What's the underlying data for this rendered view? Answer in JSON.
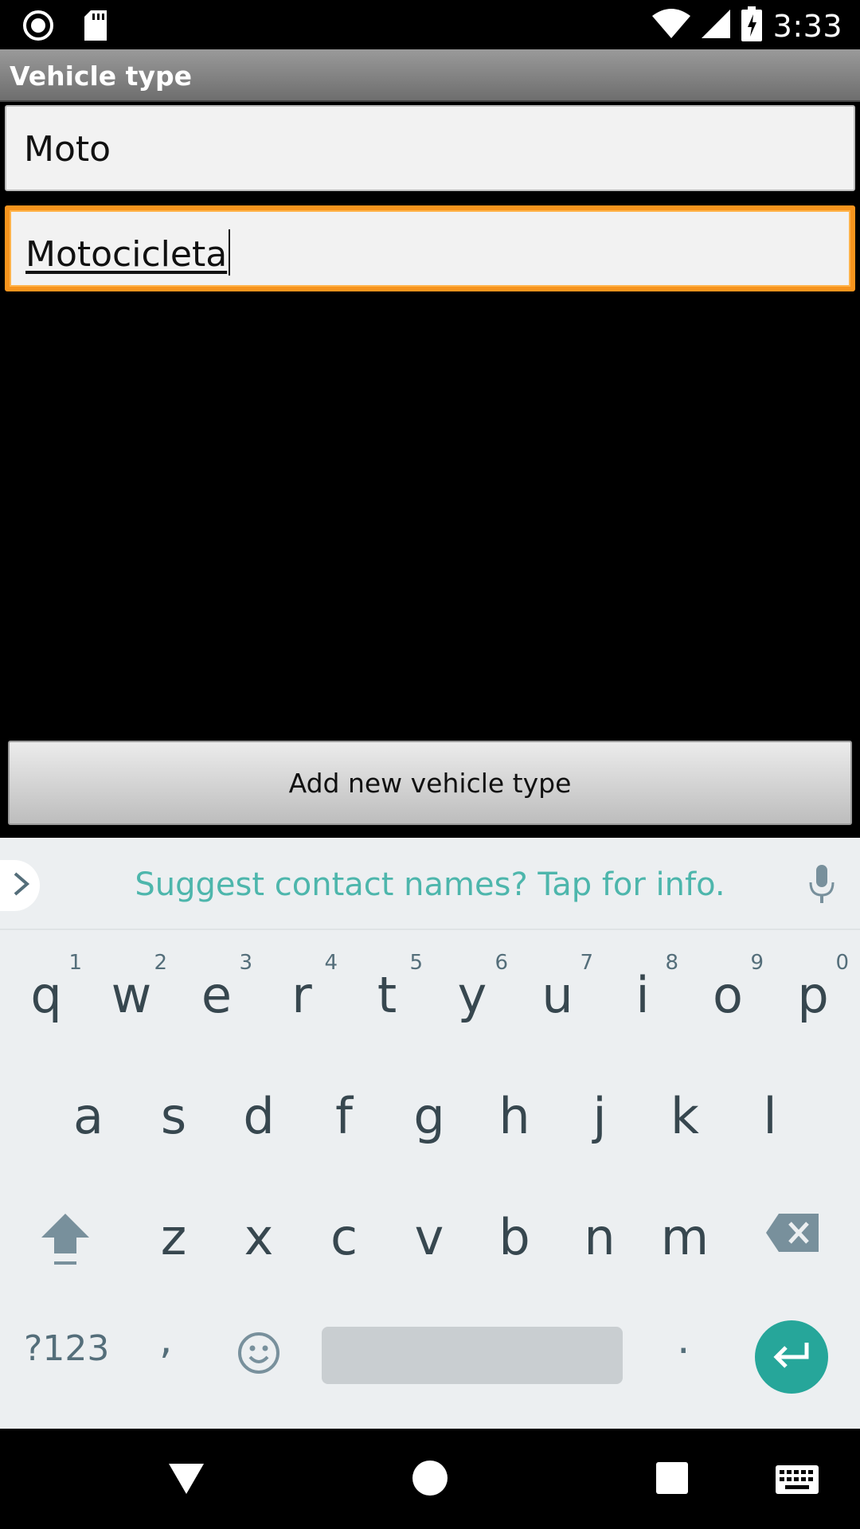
{
  "status_bar": {
    "time": "3:33",
    "left_icons": [
      "record-icon",
      "sd-card-icon"
    ],
    "right_icons": [
      "wifi-icon",
      "cell-signal-icon",
      "battery-charging-icon"
    ]
  },
  "title_bar": {
    "title": "Vehicle type"
  },
  "form": {
    "field1_value": "Moto",
    "field2_value": "Motocicleta",
    "add_button_label": "Add new vehicle type",
    "focus_color": "#f7941d"
  },
  "keyboard": {
    "suggestion": "Suggest contact names? Tap for info.",
    "accent_color": "#4db6ac",
    "row1": [
      {
        "key": "q",
        "hint": "1"
      },
      {
        "key": "w",
        "hint": "2"
      },
      {
        "key": "e",
        "hint": "3"
      },
      {
        "key": "r",
        "hint": "4"
      },
      {
        "key": "t",
        "hint": "5"
      },
      {
        "key": "y",
        "hint": "6"
      },
      {
        "key": "u",
        "hint": "7"
      },
      {
        "key": "i",
        "hint": "8"
      },
      {
        "key": "o",
        "hint": "9"
      },
      {
        "key": "p",
        "hint": "0"
      }
    ],
    "row2": [
      "a",
      "s",
      "d",
      "f",
      "g",
      "h",
      "j",
      "k",
      "l"
    ],
    "row3": [
      "z",
      "x",
      "c",
      "v",
      "b",
      "n",
      "m"
    ],
    "sym_label": "?123",
    "comma": ",",
    "period": "."
  },
  "nav_bar": {
    "icons": [
      "back-icon",
      "home-icon",
      "recents-icon",
      "keyboard-icon"
    ]
  }
}
